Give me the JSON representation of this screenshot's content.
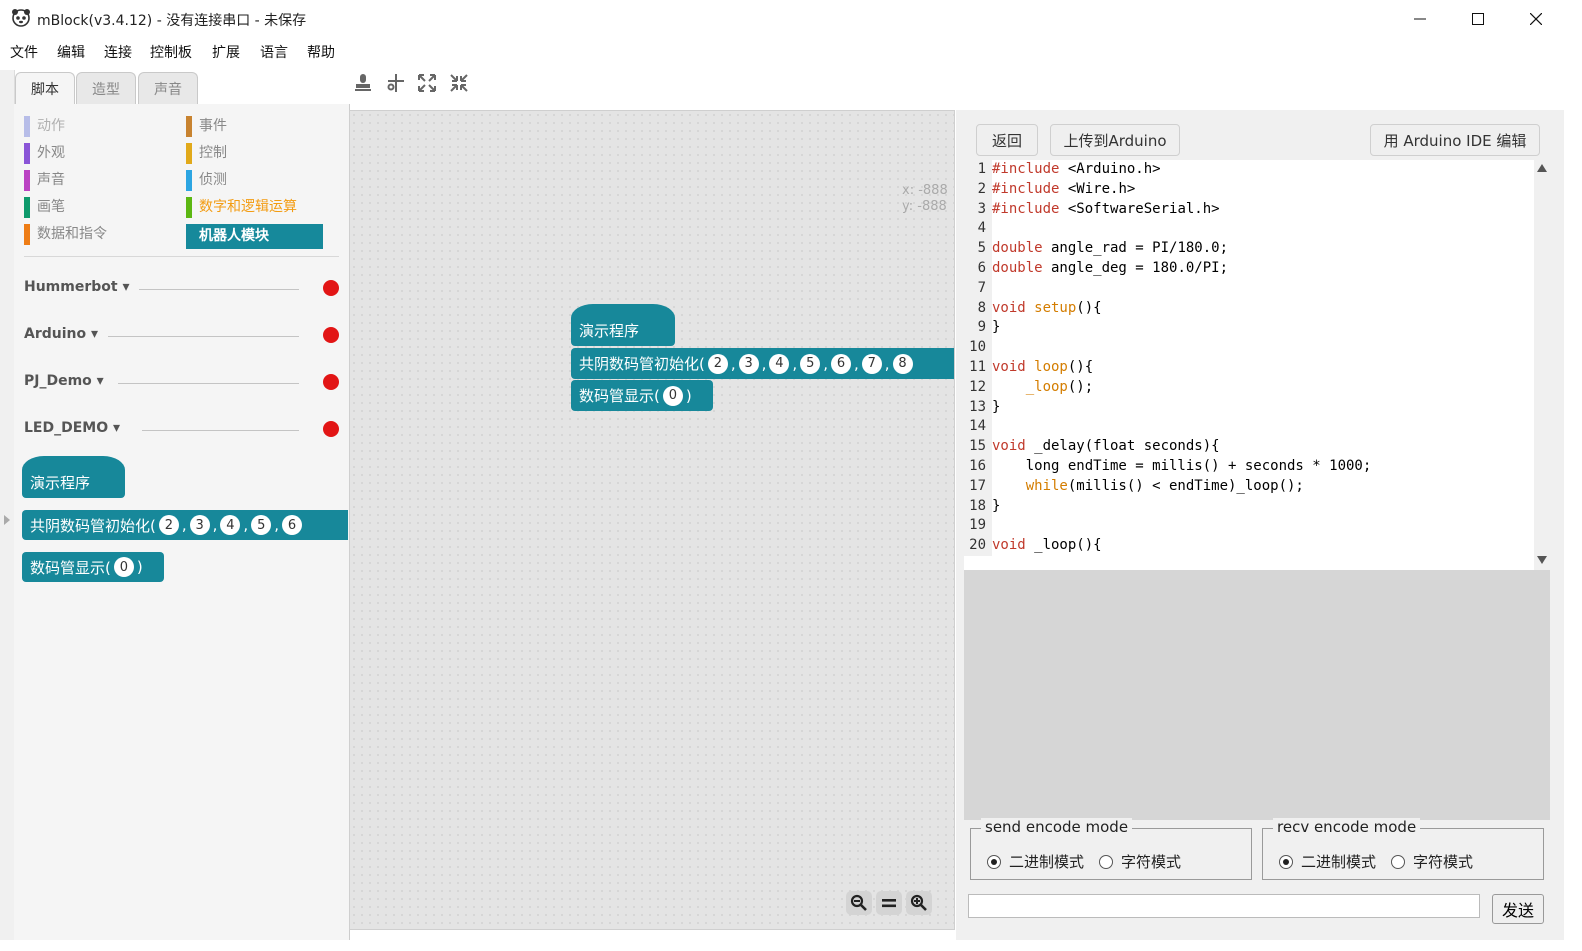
{
  "window": {
    "title": "mBlock(v3.4.12) - 没有连接串口 - 未保存",
    "controls": [
      "minimize-icon",
      "maximize-icon",
      "close-icon"
    ]
  },
  "menu": [
    "文件",
    "编辑",
    "连接",
    "控制板",
    "扩展",
    "语言",
    "帮助"
  ],
  "tabs": [
    {
      "label": "脚本",
      "active": true
    },
    {
      "label": "造型",
      "active": false
    },
    {
      "label": "声音",
      "active": false
    }
  ],
  "toolbar_icons": [
    "stamp-icon",
    "scissors-icon",
    "grow-icon",
    "shrink-icon"
  ],
  "categories": {
    "left": [
      {
        "label": "动作",
        "color": "#b7bde8",
        "text_color": "#b0b0b0"
      },
      {
        "label": "外观",
        "color": "#8a55d7",
        "text_color": "#888888"
      },
      {
        "label": "声音",
        "color": "#bb42c3",
        "text_color": "#888888"
      },
      {
        "label": "画笔",
        "color": "#0e9a6c",
        "text_color": "#888888"
      },
      {
        "label": "数据和指令",
        "color": "#ee7d16",
        "text_color": "#888888"
      }
    ],
    "right": [
      {
        "label": "事件",
        "color": "#c88330",
        "text_color": "#888888"
      },
      {
        "label": "控制",
        "color": "#e1a91a",
        "text_color": "#888888"
      },
      {
        "label": "侦测",
        "color": "#2ca5e2",
        "text_color": "#888888"
      },
      {
        "label": "数字和逻辑运算",
        "color": "#5cb712",
        "text_color": "#f39c12"
      },
      {
        "label": "机器人模块",
        "color": "#16899b",
        "text_color": "#ffffff",
        "selected": true
      }
    ]
  },
  "extensions": [
    "Hummerbot",
    "Arduino",
    "PJ_Demo",
    "LED_DEMO"
  ],
  "blocks": {
    "hat": "演示程序",
    "init": "共阴数码管初始化(",
    "init_args": [
      "2",
      "3",
      "4",
      "5",
      "6",
      "7",
      "8"
    ],
    "display": "数码管显示(",
    "display_arg": "0",
    "close_paren": ")",
    "comma": ","
  },
  "stage": {
    "x_label": "x: -888",
    "y_label": "y: -888"
  },
  "zoom": [
    "zoom-out-icon",
    "zoom-reset-icon",
    "zoom-in-icon"
  ],
  "right_buttons": {
    "back": "返回",
    "upload": "上传到Arduino",
    "ide": "用 Arduino IDE 编辑"
  },
  "code": [
    {
      "n": "1",
      "k": "#include",
      "r": " <Arduino.h>"
    },
    {
      "n": "2",
      "k": "#include",
      "r": " <Wire.h>"
    },
    {
      "n": "3",
      "k": "#include",
      "r": " <SoftwareSerial.h>"
    },
    {
      "n": "4",
      "k": "",
      "r": ""
    },
    {
      "n": "5",
      "k": "double",
      "r": " angle_rad = PI/180.0;"
    },
    {
      "n": "6",
      "k": "double",
      "r": " angle_deg = 180.0/PI;"
    },
    {
      "n": "7",
      "k": "",
      "r": ""
    },
    {
      "n": "8",
      "k": "void",
      "f": " setup",
      "r": "(){"
    },
    {
      "n": "9",
      "k": "",
      "r": "}"
    },
    {
      "n": "10",
      "k": "",
      "r": ""
    },
    {
      "n": "11",
      "k": "void",
      "f": " loop",
      "r": "(){"
    },
    {
      "n": "12",
      "k": "",
      "f": "    _loop",
      "r": "();"
    },
    {
      "n": "13",
      "k": "",
      "r": "}"
    },
    {
      "n": "14",
      "k": "",
      "r": ""
    },
    {
      "n": "15",
      "k": "void",
      "r": " _delay(float seconds){"
    },
    {
      "n": "16",
      "k": "",
      "r": "    long endTime = millis() + seconds * 1000;"
    },
    {
      "n": "17",
      "k": "",
      "f": "    while",
      "r": "(millis() < endTime)_loop();"
    },
    {
      "n": "18",
      "k": "",
      "r": "}"
    },
    {
      "n": "19",
      "k": "",
      "r": ""
    },
    {
      "n": "20",
      "k": "void",
      "r": " _loop(){"
    }
  ],
  "serial": {
    "send_mode_legend": "send encode mode",
    "recv_mode_legend": "recv encode mode",
    "binary": "二进制模式",
    "char": "字符模式",
    "send_value": "",
    "send_button": "发送"
  }
}
